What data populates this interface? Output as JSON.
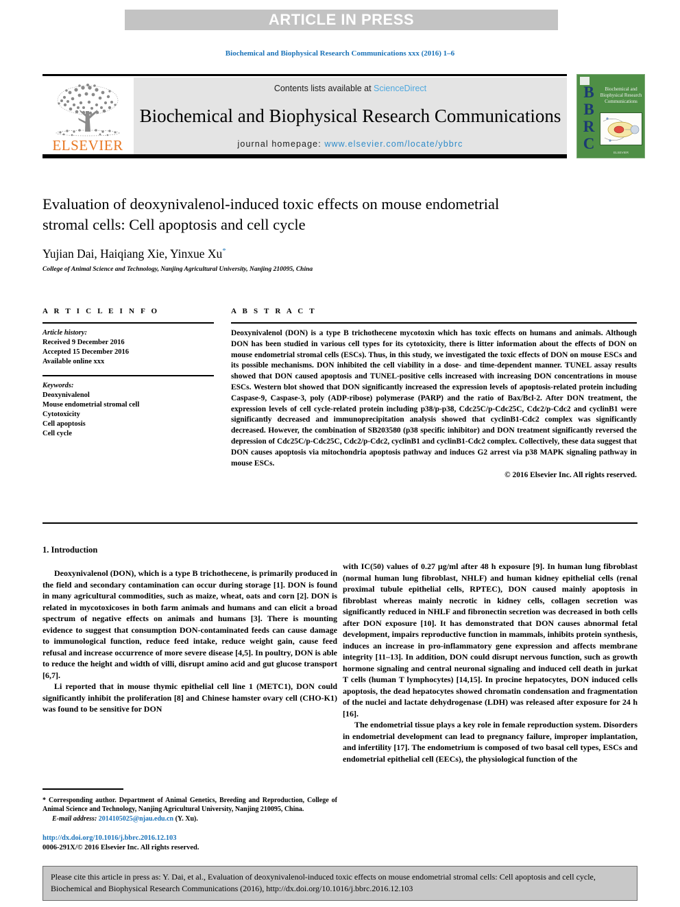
{
  "banner": {
    "text": "ARTICLE IN PRESS"
  },
  "journal_ref": "Biochemical and Biophysical Research Communications xxx (2016) 1–6",
  "masthead": {
    "contents_prefix": "Contents lists available at ",
    "sciencedirect": "ScienceDirect",
    "journal_title": "Biochemical and Biophysical Research Communications",
    "homepage_prefix": "journal homepage: ",
    "homepage_url": "www.elsevier.com/locate/ybbrc",
    "publisher": "ELSEVIER",
    "cover": {
      "letters": "BBRC",
      "title_lines": "Biochemical and Biophysical Research Communications",
      "footer": "ELSEVIER"
    }
  },
  "article": {
    "title": "Evaluation of deoxynivalenol-induced toxic effects on mouse endometrial stromal cells: Cell apoptosis and cell cycle",
    "authors": "Yujian Dai, Haiqiang Xie, Yinxue Xu",
    "corresponding_marker": "*",
    "affiliation": "College of Animal Science and Technology, Nanjing Agricultural University, Nanjing 210095, China"
  },
  "article_info": {
    "heading": "A R T I C L E  I N F O",
    "history_label": "Article history:",
    "history": [
      "Received 9 December 2016",
      "Accepted 15 December 2016",
      "Available online xxx"
    ],
    "keywords_label": "Keywords:",
    "keywords": [
      "Deoxynivalenol",
      "Mouse endometrial stromal cell",
      "Cytotoxicity",
      "Cell apoptosis",
      "Cell cycle"
    ]
  },
  "abstract": {
    "heading": "A B S T R A C T",
    "text_part1": "Deoxynivalenol (DON) is a type B trichothecene mycotoxin which has toxic effects on humans and animals. Although DON has been studied in various cell types for its cytotoxicity, there is litter information about the effects of DON on mouse endometrial stromal cells (ESCs). Thus, in this study, we investigated the toxic effects of DON on mouse ESCs and its possible mechanisms. DON inhibited the cell viability in a dose- and time-dependent manner. TUNEL assay results showed that DON caused apoptosis and TUNEL-positive cells increased with increasing DON concentrations in mouse ESCs. Western blot showed that DON significantly increased the expression levels of apoptosis-related protein including Caspase-9, Caspase-3, poly (ADP-ribose) polymerase (PARP) and the ratio of Bax/Bcl-2. After DON treatment, the expression levels of cell cycle-related protein including p38/p-p38, Cdc25C/p-Cdc25C, Cdc2/p-Cdc2 and cyclinB1 were significantly decreased and immunoprecipitation analysis showed that cyclinB1-Cdc2 complex was significantly decreased. However, the combination of SB203580 (p38 specific inhibitor) and DON treatment significantly reversed the depression of Cdc25C/p-Cdc25C, Cdc2/p-Cdc2, cyclinB1 and cyclinB1-Cdc2 complex. Collectively, these data suggest that DON causes apoptosis via mitochondria apoptosis pathway and induces G2 arrest via p38 MAPK signaling pathway in mouse ESCs.",
    "copyright": "© 2016 Elsevier Inc. All rights reserved."
  },
  "introduction": {
    "heading": "1. Introduction",
    "left_paragraphs": [
      "Deoxynivalenol (DON), which is a type B trichothecene, is primarily produced in the field and secondary contamination can occur during storage [1]. DON is found in many agricultural commodities, such as maize, wheat, oats and corn [2]. DON is related in mycotoxicoses in both farm animals and humans and can elicit a broad spectrum of negative effects on animals and humans [3]. There is mounting evidence to suggest that consumption DON-contaminated feeds can cause damage to immunological function, reduce feed intake, reduce weight gain, cause feed refusal and increase occurrence of more severe disease [4,5]. In poultry, DON is able to reduce the height and width of villi, disrupt amino acid and gut glucose transport [6,7].",
      "Li reported that in mouse thymic epithelial cell line 1 (METC1), DON could significantly inhibit the proliferation [8] and Chinese hamster ovary cell (CHO-K1) was found to be sensitive for DON"
    ],
    "right_paragraphs": [
      "with IC(50) values of 0.27 μg/ml after 48 h exposure [9]. In human lung fibroblast (normal human lung fibroblast, NHLF) and human kidney epithelial cells (renal proximal tubule epithelial cells, RPTEC), DON caused mainly apoptosis in fibroblast whereas mainly necrotic in kidney cells, collagen secretion was significantly reduced in NHLF and fibronectin secretion was decreased in both cells after DON exposure [10]. It has demonstrated that DON causes abnormal fetal development, impairs reproductive function in mammals, inhibits protein synthesis, induces an increase in pro-inflammatory gene expression and affects membrane integrity [11–13]. In addition, DON could disrupt nervous function, such as growth hormone signaling and central neuronal signaling and induced cell death in jurkat T cells (human T lymphocytes) [14,15]. In procine hepatocytes, DON induced cells apoptosis, the dead hepatocytes showed chromatin condensation and fragmentation of the nuclei and lactate dehydrogenase (LDH) was released after exposure for 24 h [16].",
      "The endometrial tissue plays a key role in female reproduction system. Disorders in endometrial development can lead to pregnancy failure, improper implantation, and infertility [17]. The endometrium is composed of two basal cell types, ESCs and endometrial epithelial cell (EECs), the physiological function of the"
    ]
  },
  "footnote": {
    "corresponding": "* Corresponding author. Department of Animal Genetics, Breeding and Reproduction, College of Animal Science and Technology, Nanjing Agricultural University, Nanjing 210095, China.",
    "email_label": "E-mail address:",
    "email": "2014105025@njau.edu.cn",
    "email_owner": "(Y. Xu)."
  },
  "doi": {
    "url": "http://dx.doi.org/10.1016/j.bbrc.2016.12.103",
    "issn_line": "0006-291X/© 2016 Elsevier Inc. All rights reserved."
  },
  "cite_box": {
    "text": "Please cite this article in press as: Y. Dai, et al., Evaluation of deoxynivalenol-induced toxic effects on mouse endometrial stromal cells: Cell apoptosis and cell cycle, Biochemical and Biophysical Research Communications (2016), http://dx.doi.org/10.1016/j.bbrc.2016.12.103"
  },
  "colors": {
    "banner_bg": "#c3c3c3",
    "link_blue": "#1a72b8",
    "sciencedirect_blue": "#4ea8df",
    "elsevier_orange": "#e87722",
    "cover_green": "#4f8f46",
    "cover_letters": "#1b3a72",
    "cite_box_bg": "#c8c8c8"
  }
}
